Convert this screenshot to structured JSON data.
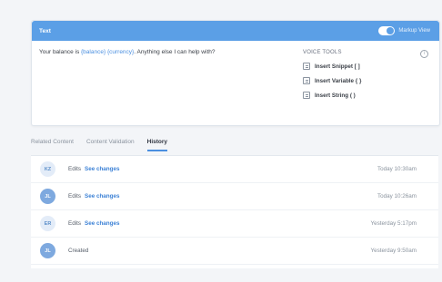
{
  "panel": {
    "title": "Text",
    "toggle_label": "Markup View",
    "message_parts": {
      "prefix": "Your balance is ",
      "token1": "{balance}",
      "space": " ",
      "token2": "{currency}",
      "suffix": ". Anything else I can help with?"
    },
    "voice_tools": {
      "title": "VOICE TOOLS",
      "info_icon": "i",
      "items": [
        {
          "label": "Insert Snippet [ ]",
          "icon": "snippet-icon"
        },
        {
          "label": "Insert Variable { }",
          "icon": "variable-icon"
        },
        {
          "label": "Insert String ( )",
          "icon": "string-icon"
        }
      ]
    }
  },
  "tabs": [
    {
      "label": "Related Content"
    },
    {
      "label": "Content Validation"
    },
    {
      "label": "History"
    }
  ],
  "history": [
    {
      "initials": "KZ",
      "action": "Edits",
      "link": "See changes",
      "time": "Today 10:30am"
    },
    {
      "initials": "JL",
      "action": "Edits",
      "link": "See changes",
      "time": "Today 10:26am"
    },
    {
      "initials": "ER",
      "action": "Edits",
      "link": "See changes",
      "time": "Yesterday 5:17pm"
    },
    {
      "initials": "JL",
      "action": "Created",
      "link": "",
      "time": "Yesterday 9:50am"
    }
  ],
  "colors": {
    "header": "#5b9fe6",
    "accent": "#4a8fe0",
    "link": "#3d82d6"
  }
}
